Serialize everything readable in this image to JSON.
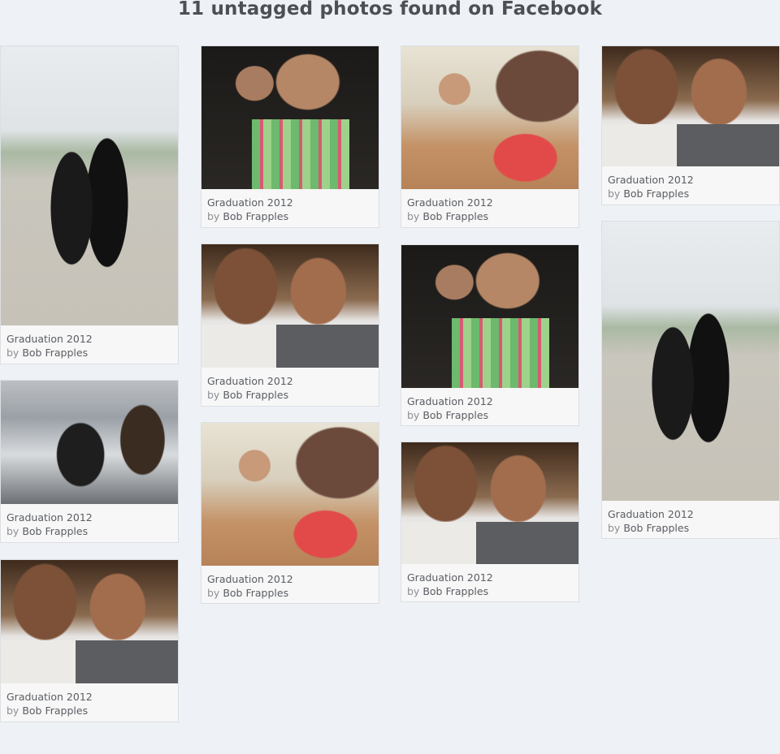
{
  "page": {
    "title": "11 untagged photos found on Facebook"
  },
  "photos": [
    {
      "scene": "outdoor-couple",
      "title": "Graduation 2012",
      "by_prefix": "by",
      "author": "Bob Frapples"
    },
    {
      "scene": "street-group",
      "title": "Graduation 2012",
      "by_prefix": "by",
      "author": "Bob Frapples"
    },
    {
      "scene": "indoor-duo",
      "title": "Graduation 2012",
      "by_prefix": "by",
      "author": "Bob Frapples"
    },
    {
      "scene": "plaid-duo",
      "title": "Graduation 2012",
      "by_prefix": "by",
      "author": "Bob Frapples"
    },
    {
      "scene": "indoor-duo",
      "title": "Graduation 2012",
      "by_prefix": "by",
      "author": "Bob Frapples"
    },
    {
      "scene": "headphones",
      "title": "Graduation 2012",
      "by_prefix": "by",
      "author": "Bob Frapples"
    },
    {
      "scene": "headphones",
      "title": "Graduation 2012",
      "by_prefix": "by",
      "author": "Bob Frapples"
    },
    {
      "scene": "plaid-duo",
      "title": "Graduation 2012",
      "by_prefix": "by",
      "author": "Bob Frapples"
    },
    {
      "scene": "indoor-duo",
      "title": "Graduation 2012",
      "by_prefix": "by",
      "author": "Bob Frapples"
    },
    {
      "scene": "indoor-duo",
      "title": "Graduation 2012",
      "by_prefix": "by",
      "author": "Bob Frapples"
    },
    {
      "scene": "outdoor-couple",
      "title": "Graduation 2012",
      "by_prefix": "by",
      "author": "Bob Frapples"
    }
  ]
}
